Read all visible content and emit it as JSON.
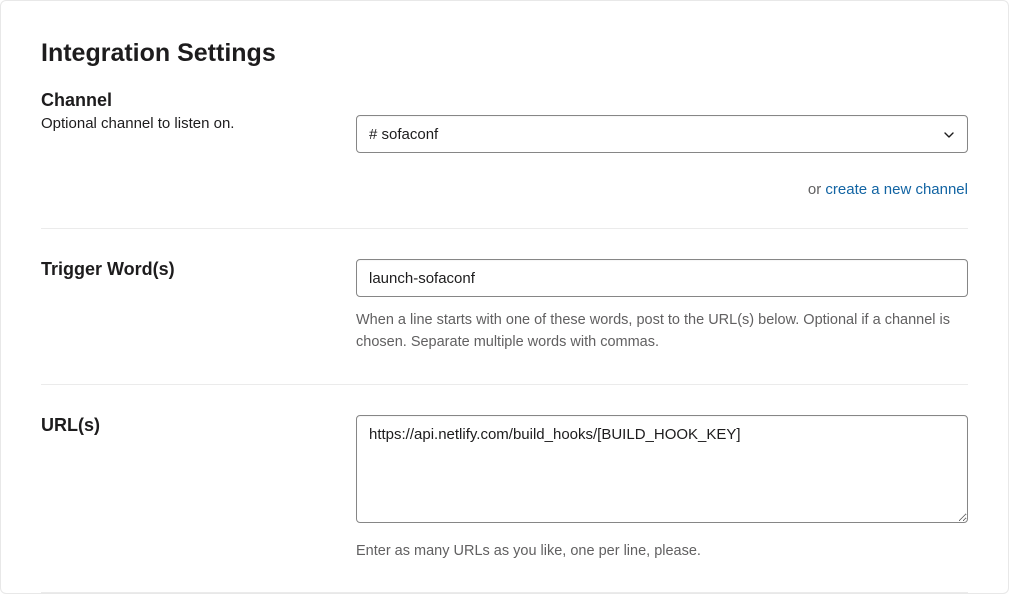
{
  "title": "Integration Settings",
  "channel": {
    "label": "Channel",
    "description": "Optional channel to listen on.",
    "selected": "# sofaconf",
    "orText": "or ",
    "createLink": "create a new channel"
  },
  "trigger": {
    "label": "Trigger Word(s)",
    "value": "launch-sofaconf",
    "help": "When a line starts with one of these words, post to the URL(s) below. Optional if a channel is chosen. Separate multiple words with commas."
  },
  "urls": {
    "label": "URL(s)",
    "value": "https://api.netlify.com/build_hooks/[BUILD_HOOK_KEY]",
    "help": "Enter as many URLs as you like, one per line, please."
  }
}
